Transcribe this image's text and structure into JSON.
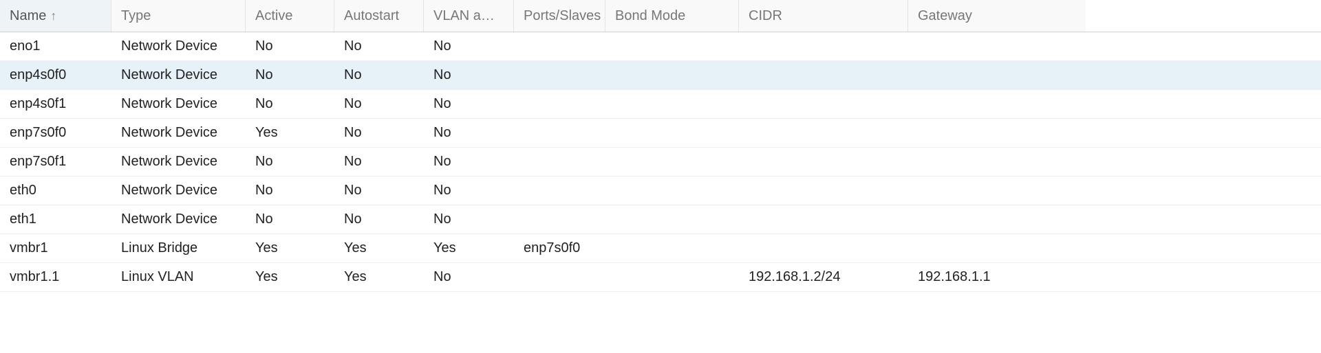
{
  "columns": [
    {
      "label": "Name",
      "sorted": "asc"
    },
    {
      "label": "Type"
    },
    {
      "label": "Active"
    },
    {
      "label": "Autostart"
    },
    {
      "label": "VLAN a…"
    },
    {
      "label": "Ports/Slaves"
    },
    {
      "label": "Bond Mode"
    },
    {
      "label": "CIDR"
    },
    {
      "label": "Gateway"
    }
  ],
  "rows": [
    {
      "name": "eno1",
      "type": "Network Device",
      "active": "No",
      "autostart": "No",
      "vlan": "No",
      "ports": "",
      "bond": "",
      "cidr": "",
      "gw": ""
    },
    {
      "name": "enp4s0f0",
      "type": "Network Device",
      "active": "No",
      "autostart": "No",
      "vlan": "No",
      "ports": "",
      "bond": "",
      "cidr": "",
      "gw": "",
      "selected": true
    },
    {
      "name": "enp4s0f1",
      "type": "Network Device",
      "active": "No",
      "autostart": "No",
      "vlan": "No",
      "ports": "",
      "bond": "",
      "cidr": "",
      "gw": ""
    },
    {
      "name": "enp7s0f0",
      "type": "Network Device",
      "active": "Yes",
      "autostart": "No",
      "vlan": "No",
      "ports": "",
      "bond": "",
      "cidr": "",
      "gw": ""
    },
    {
      "name": "enp7s0f1",
      "type": "Network Device",
      "active": "No",
      "autostart": "No",
      "vlan": "No",
      "ports": "",
      "bond": "",
      "cidr": "",
      "gw": ""
    },
    {
      "name": "eth0",
      "type": "Network Device",
      "active": "No",
      "autostart": "No",
      "vlan": "No",
      "ports": "",
      "bond": "",
      "cidr": "",
      "gw": ""
    },
    {
      "name": "eth1",
      "type": "Network Device",
      "active": "No",
      "autostart": "No",
      "vlan": "No",
      "ports": "",
      "bond": "",
      "cidr": "",
      "gw": ""
    },
    {
      "name": "vmbr1",
      "type": "Linux Bridge",
      "active": "Yes",
      "autostart": "Yes",
      "vlan": "Yes",
      "ports": "enp7s0f0",
      "bond": "",
      "cidr": "",
      "gw": ""
    },
    {
      "name": "vmbr1.1",
      "type": "Linux VLAN",
      "active": "Yes",
      "autostart": "Yes",
      "vlan": "No",
      "ports": "",
      "bond": "",
      "cidr": "192.168.1.2/24",
      "gw": "192.168.1.1"
    }
  ],
  "sort_arrow": "↑"
}
